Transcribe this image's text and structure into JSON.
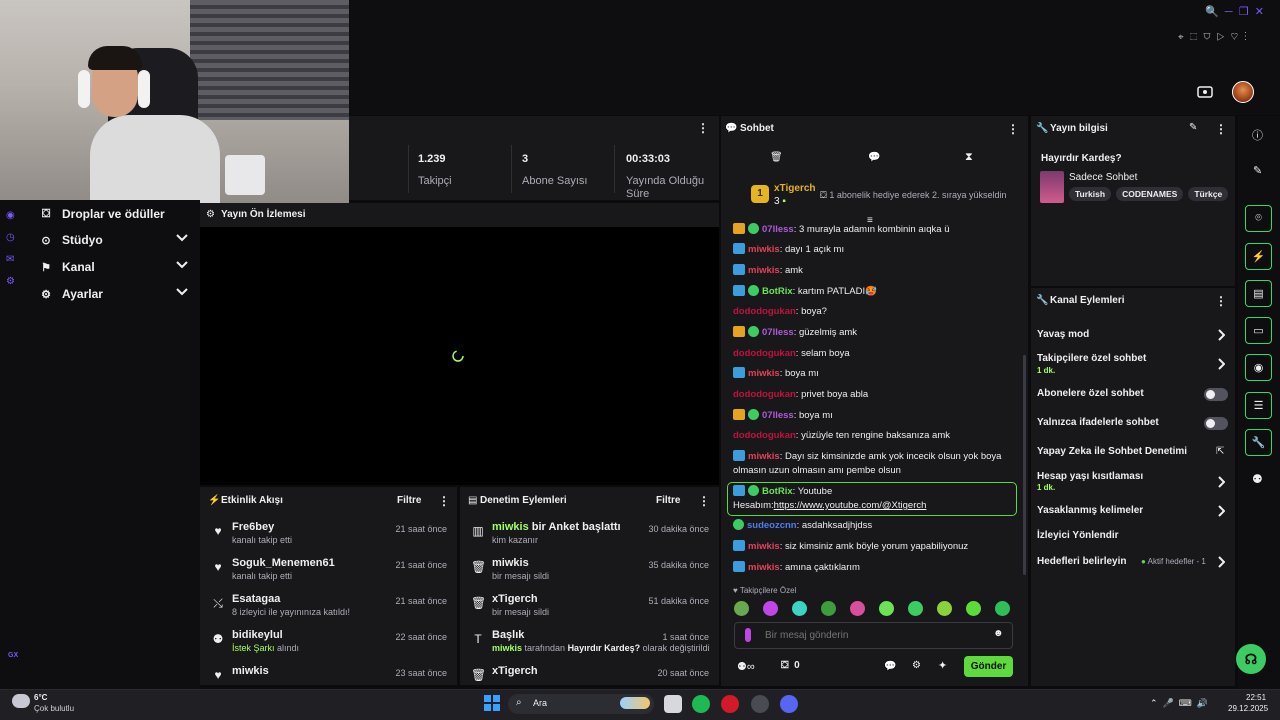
{
  "colors": {
    "accent": "#a3ff5c",
    "panel": "#18181b",
    "bg": "#0e0e10",
    "send": "#5cdb3a"
  },
  "stats": [
    {
      "value": "1.239",
      "label": "Takipçi"
    },
    {
      "value": "3",
      "label": "Abone Sayısı"
    },
    {
      "value": "00:33:03",
      "label": "Yayında Olduğu Süre"
    }
  ],
  "nav": [
    {
      "icon": "drops-icon",
      "label": "Droplar ve ödüller"
    },
    {
      "icon": "studio-icon",
      "label": "Stüdyo"
    },
    {
      "icon": "channel-icon",
      "label": "Kanal"
    },
    {
      "icon": "gear-icon",
      "label": "Ayarlar"
    }
  ],
  "preview": {
    "title": "Yayın Ön İzlemesi"
  },
  "activity": {
    "title": "Etkinlik Akışı",
    "filter": "Filtre",
    "items": [
      {
        "icon": "heart-icon",
        "name": "Fre6bey",
        "sub": "kanalı takip etti",
        "time": "21 saat önce"
      },
      {
        "icon": "heart-icon",
        "name": "Soguk_Menemen61",
        "sub": "kanalı takip etti",
        "time": "21 saat önce"
      },
      {
        "icon": "raid-icon",
        "name": "Esatagaa",
        "sub": "8 izleyici ile yayınınıza katıldı!",
        "time": "21 saat önce"
      },
      {
        "icon": "song-icon",
        "name": "bidikeylul",
        "sub_hl": "İstek Şarkı",
        "sub": " alındı",
        "time": "22 saat önce"
      },
      {
        "icon": "heart-icon",
        "name": "miwkis",
        "sub": "",
        "time": "23 saat önce"
      }
    ]
  },
  "moderation": {
    "title": "Denetim Eylemleri",
    "filter": "Filtre",
    "items": [
      {
        "icon": "poll-icon",
        "name_hl": "miwkis",
        "name": " bir Anket başlattı",
        "sub": "kim kazanır",
        "time": "30 dakika önce"
      },
      {
        "icon": "trash-icon",
        "name": "miwkis",
        "sub": "bir mesajı sildi",
        "time": "35 dakika önce"
      },
      {
        "icon": "trash-icon",
        "name": "xTigerch",
        "sub": "bir mesajı sildi",
        "time": "51 dakika önce"
      },
      {
        "icon": "title-icon",
        "name": "Başlık",
        "sub_hl": "miwkis",
        "sub": " tarafından ",
        "sub_b": "Hayırdır Kardeş?",
        "sub_end": " olarak değiştirildi",
        "time": "1 saat önce"
      },
      {
        "icon": "trash-icon",
        "name": "xTigerch",
        "sub": "",
        "time": "20 saat önce"
      }
    ]
  },
  "chat": {
    "title": "Sohbet",
    "pinned_user": "xTigerch",
    "pinned_count": "3",
    "pinned_text": "1 abonelik hediye ederek 2. sıraya yükseldin",
    "messages": [
      {
        "badges": [
          "gold",
          "green"
        ],
        "user": "07lless",
        "ucls": "u-purple",
        "text": ": 3 murayla adamın kombinin aıqka ü"
      },
      {
        "badges": [
          "blue"
        ],
        "user": "miwkis",
        "ucls": "u-pink",
        "text": ": dayı 1 açık mı"
      },
      {
        "badges": [
          "blue"
        ],
        "user": "miwkis",
        "ucls": "u-pink",
        "text": ": amk"
      },
      {
        "badges": [
          "blue",
          "green"
        ],
        "user": "BotRix",
        "ucls": "u-green",
        "text": ": kartım PATLADI🥵"
      },
      {
        "badges": [],
        "user": "dododogukan",
        "ucls": "u-red",
        "text": ": boya?"
      },
      {
        "badges": [
          "gold",
          "green"
        ],
        "user": "07lless",
        "ucls": "u-purple",
        "text": ": güzelmiş amk"
      },
      {
        "badges": [],
        "user": "dododogukan",
        "ucls": "u-red",
        "text": ": selam boya"
      },
      {
        "badges": [
          "blue"
        ],
        "user": "miwkis",
        "ucls": "u-pink",
        "text": ": boya mı"
      },
      {
        "badges": [],
        "user": "dododogukan",
        "ucls": "u-red",
        "text": ": privet boya abla"
      },
      {
        "badges": [
          "gold",
          "green"
        ],
        "user": "07lless",
        "ucls": "u-purple",
        "text": ": boya mı"
      },
      {
        "badges": [],
        "user": "dododogukan",
        "ucls": "u-red",
        "text": ": yüzüyle ten rengine baksanıza amk"
      },
      {
        "badges": [
          "blue"
        ],
        "user": "miwkis",
        "ucls": "u-pink",
        "text": ": Dayı siz kimsinizde amk yok incecik olsun yok boya olmasın uzun olmasın amı pembe olsun"
      }
    ],
    "highlight": {
      "user": "BotRix",
      "text": ": Youtube Hesabım:",
      "link": "https://www.youtube.com/@Xtigerch"
    },
    "messages2": [
      {
        "badges": [
          "green"
        ],
        "user": "sudeozcnn",
        "ucls": "u-blue",
        "text": ": asdahksadjhjdss"
      },
      {
        "badges": [
          "blue"
        ],
        "user": "miwkis",
        "ucls": "u-pink",
        "text": ": siz kimsiniz amk böyle yorum yapabiliyonuz"
      },
      {
        "badges": [
          "blue"
        ],
        "user": "miwkis",
        "ucls": "u-pink",
        "text": ": amına çaktıklarım"
      }
    ],
    "emote_label": "Takipçilere Özel",
    "input_placeholder": "Bir mesaj gönderin",
    "count": "0",
    "send": "Gönder"
  },
  "stream_info": {
    "title": "Yayın bilgisi",
    "stream_title": "Hayırdır Kardeş?",
    "category": "Sadece Sohbet",
    "tags": [
      "Turkish",
      "CODENAMES",
      "Türkçe"
    ]
  },
  "channel_actions": {
    "title": "Kanal Eylemleri",
    "slow": "Yavaş mod",
    "followers": "Takipçilere özel sohbet",
    "followers_sub": "1 dk.",
    "subs": "Abonelere özel sohbet",
    "emotes": "Yalnızca ifadelerle sohbet",
    "ai": "Yapay Zeka ile Sohbet Denetimi",
    "age": "Hesap yaşı kısıtlaması",
    "age_sub": "1 dk.",
    "banned": "Yasaklanmış kelimeler",
    "redirect": "İzleyici Yönlendir",
    "goals": "Hedefleri belirleyin",
    "goals_status": "Aktif hedefler - 1"
  },
  "taskbar": {
    "weather_temp": "6°C",
    "weather_desc": "Çok bulutlu",
    "search": "Ara",
    "time": "22:51",
    "date": "29.12.2025"
  },
  "misc": {
    "gx": "GX"
  }
}
